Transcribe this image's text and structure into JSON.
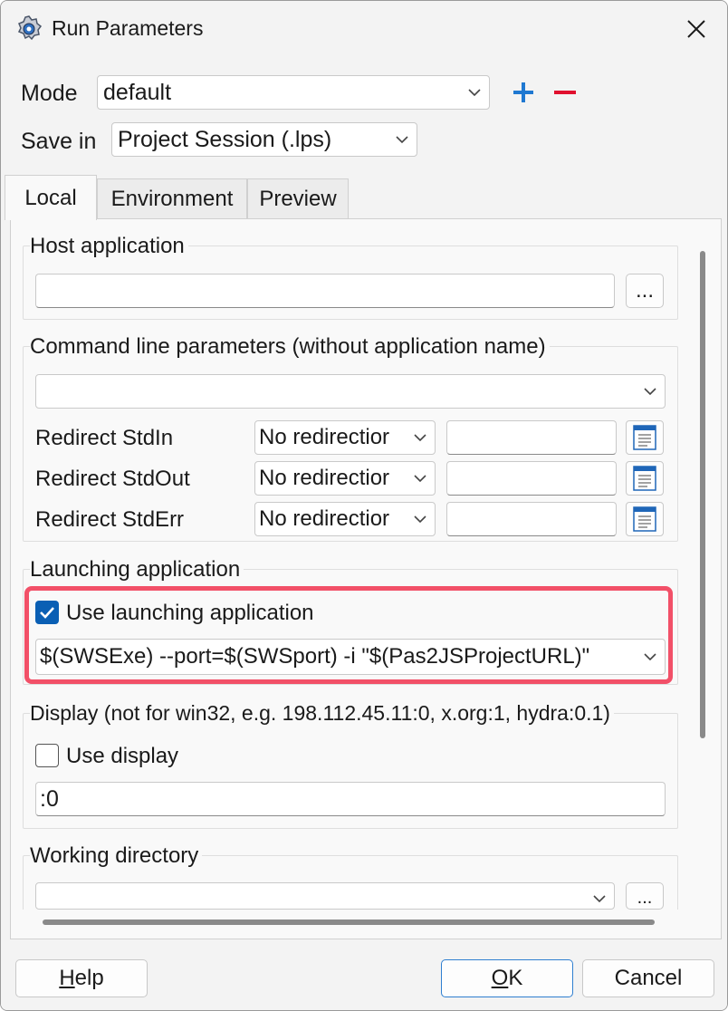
{
  "window": {
    "title": "Run Parameters"
  },
  "mode": {
    "label": "Mode",
    "value": "default",
    "add_icon": "plus-icon",
    "remove_icon": "minus-icon"
  },
  "save_in": {
    "label": "Save in",
    "value": "Project Session (.lps)"
  },
  "tabs": [
    {
      "label": "Local",
      "active": true
    },
    {
      "label": "Environment",
      "active": false
    },
    {
      "label": "Preview",
      "active": false
    }
  ],
  "host_application": {
    "title": "Host application",
    "value": "",
    "browse_label": "..."
  },
  "command_line": {
    "title": "Command line parameters (without application name)",
    "value": "",
    "redirects": [
      {
        "label": "Redirect StdIn",
        "mode": "No redirectior",
        "file": ""
      },
      {
        "label": "Redirect StdOut",
        "mode": "No redirectior",
        "file": ""
      },
      {
        "label": "Redirect StdErr",
        "mode": "No redirectior",
        "file": ""
      }
    ]
  },
  "launching": {
    "title": "Launching application",
    "checkbox_label": "Use launching application",
    "checked": true,
    "value": "$(SWSExe) --port=$(SWSport) -i \"$(Pas2JSProjectURL)\""
  },
  "display": {
    "title": "Display (not for win32, e.g. 198.112.45.11:0, x.org:1, hydra:0.1)",
    "checkbox_label": "Use display",
    "checked": false,
    "value": ":0"
  },
  "working_directory": {
    "title": "Working directory",
    "value": "",
    "browse_label": "..."
  },
  "buttons": {
    "help": "Help",
    "ok": "OK",
    "cancel": "Cancel"
  },
  "colors": {
    "accent": "#0a5fb4",
    "plus": "#1f78d1",
    "minus": "#e0102e",
    "highlight": "#f25068"
  }
}
